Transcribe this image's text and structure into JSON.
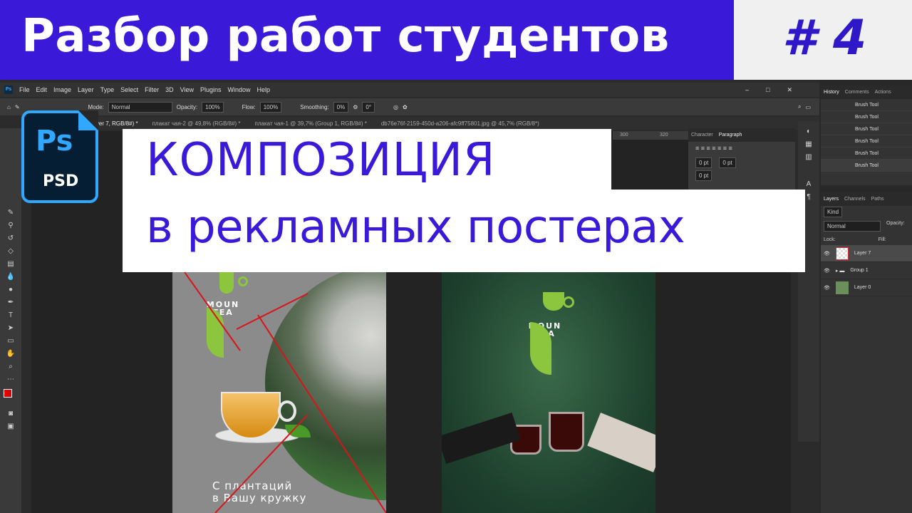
{
  "banner": {
    "title": "Разбор работ студентов",
    "episode": "# 4"
  },
  "overlay": {
    "line1": "КОМПОЗИЦИЯ",
    "line2": "в рекламных постерах"
  },
  "psbadge": {
    "short": "Ps",
    "ext": "PSD"
  },
  "menu": [
    "File",
    "Edit",
    "Image",
    "Layer",
    "Type",
    "Select",
    "Filter",
    "3D",
    "View",
    "Plugins",
    "Window",
    "Help"
  ],
  "options": {
    "mode_label": "Mode:",
    "mode_value": "Normal",
    "opacity_label": "Opacity:",
    "opacity_value": "100%",
    "flow_label": "Flow:",
    "flow_value": "100%",
    "smoothing_label": "Smoothing:",
    "smoothing_value": "0%",
    "angle_value": "0°"
  },
  "tabs": [
    "Layer 7, RGB/8#) *",
    "плакат чая-2 @ 49,8% (RGB/8#) *",
    "плакат чая-1 @ 39,7% (Group 1, RGB/8#) *",
    "db76e76f-2159-450d-a206-afc9ff75801.jpg @ 45,7% (RGB/8*)"
  ],
  "ruler": {
    "labels": [
      "300",
      "320"
    ]
  },
  "char_panel": {
    "tabs": [
      "Character",
      "Paragraph"
    ],
    "indent1": "0 pt",
    "indent2": "0 pt",
    "indent3": "0 pt"
  },
  "history": {
    "tabs": [
      "History",
      "Comments",
      "Actions"
    ],
    "items": [
      "Brush Tool",
      "Brush Tool",
      "Brush Tool",
      "Brush Tool",
      "Brush Tool",
      "Brush Tool"
    ]
  },
  "layers": {
    "tabs": [
      "Layers",
      "Channels",
      "Paths"
    ],
    "kind": "Kind",
    "blend": "Normal",
    "opacity_label": "Opacity:",
    "lock_label": "Lock:",
    "fill_label": "Fill:",
    "items": [
      "Layer 7",
      "Group 1",
      "Layer 0"
    ]
  },
  "poster1": {
    "logo": "MOUN\nTEA",
    "caption": "С плантаций\nв Вашу кружку"
  },
  "poster2": {
    "logo": "MOUN\nTEA"
  },
  "colors": {
    "accent": "#3a1ad8",
    "ps_blue": "#31a8ff",
    "leaf_green": "#8cc63f"
  }
}
